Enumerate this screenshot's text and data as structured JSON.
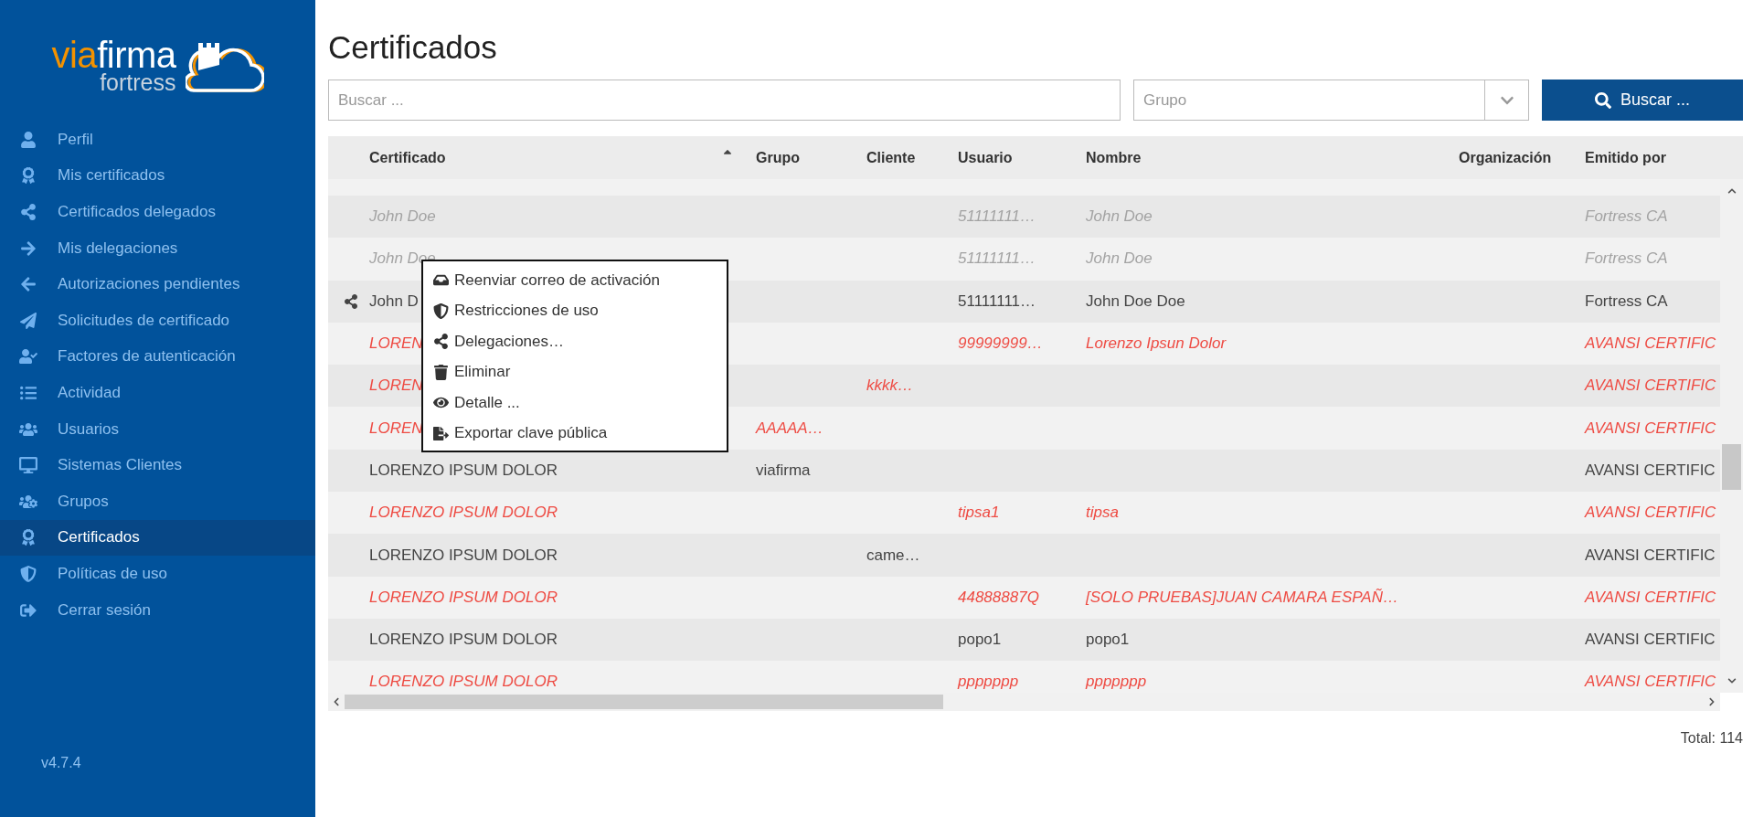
{
  "logo": {
    "accent": "via",
    "name": "firma",
    "tagline": "fortress"
  },
  "sidebar": {
    "items": [
      {
        "label": "Perfil",
        "selected": false
      },
      {
        "label": "Mis certificados",
        "selected": false
      },
      {
        "label": "Certificados delegados",
        "selected": false
      },
      {
        "label": "Mis delegaciones",
        "selected": false
      },
      {
        "label": "Autorizaciones pendientes",
        "selected": false
      },
      {
        "label": "Solicitudes de certificado",
        "selected": false
      },
      {
        "label": "Factores de autenticación",
        "selected": false
      },
      {
        "label": "Actividad",
        "selected": false
      },
      {
        "label": "Usuarios",
        "selected": false
      },
      {
        "label": "Sistemas Clientes",
        "selected": false
      },
      {
        "label": "Grupos",
        "selected": false
      },
      {
        "label": "Certificados",
        "selected": true
      },
      {
        "label": "Políticas de uso",
        "selected": false
      },
      {
        "label": "Cerrar sesión",
        "selected": false
      }
    ],
    "version": "v4.7.4"
  },
  "page_title": "Certificados",
  "search": {
    "placeholder": "Buscar ..."
  },
  "group_select": {
    "placeholder": "Grupo"
  },
  "search_button": "Buscar ...",
  "table": {
    "columns": [
      {
        "label": "Certificado",
        "sorted": true
      },
      {
        "label": "Grupo",
        "sorted": false
      },
      {
        "label": "Cliente",
        "sorted": false
      },
      {
        "label": "Usuario",
        "sorted": false
      },
      {
        "label": "Nombre",
        "sorted": false
      },
      {
        "label": "Organización",
        "sorted": false
      },
      {
        "label": "Emitido por",
        "sorted": false
      }
    ],
    "rows": [
      {
        "kind": "muted",
        "shared": false,
        "cells": [
          "John Doe",
          null,
          null,
          "51111111…",
          "John Doe",
          null,
          "Fortress CA"
        ]
      },
      {
        "kind": "muted",
        "shared": false,
        "cells": [
          "John Doe",
          null,
          null,
          "51111111…",
          "John Doe",
          null,
          "Fortress CA"
        ]
      },
      {
        "kind": "normal",
        "shared": true,
        "cells": [
          "John D",
          null,
          null,
          "51111111…",
          "John Doe Doe",
          null,
          "Fortress CA"
        ]
      },
      {
        "kind": "alert",
        "shared": false,
        "cells": [
          "LOREN",
          null,
          null,
          "99999999…",
          "Lorenzo Ipsun Dolor",
          null,
          "AVANSI CERTIFIC"
        ]
      },
      {
        "kind": "alert",
        "shared": false,
        "cells": [
          "LOREN",
          null,
          "kkkk…",
          null,
          null,
          null,
          "AVANSI CERTIFIC"
        ]
      },
      {
        "kind": "alert",
        "shared": false,
        "cells": [
          "LOREN",
          "AAAAA…",
          null,
          null,
          null,
          null,
          "AVANSI CERTIFIC"
        ]
      },
      {
        "kind": "normal",
        "shared": false,
        "cells": [
          "LORENZO IPSUM DOLOR",
          "viafirma",
          null,
          null,
          null,
          null,
          "AVANSI CERTIFIC"
        ]
      },
      {
        "kind": "alert",
        "shared": false,
        "cells": [
          "LORENZO IPSUM DOLOR",
          null,
          null,
          "tipsa1",
          "tipsa",
          null,
          "AVANSI CERTIFIC"
        ]
      },
      {
        "kind": "normal",
        "shared": false,
        "cells": [
          "LORENZO IPSUM DOLOR",
          null,
          "came…",
          null,
          null,
          null,
          "AVANSI CERTIFIC"
        ]
      },
      {
        "kind": "alert",
        "shared": false,
        "cells": [
          "LORENZO IPSUM DOLOR",
          null,
          null,
          "44888887Q",
          "[SOLO PRUEBAS]JUAN CAMARA ESPAÑ…",
          null,
          "AVANSI CERTIFIC"
        ]
      },
      {
        "kind": "normal",
        "shared": false,
        "cells": [
          "LORENZO IPSUM DOLOR",
          null,
          null,
          "popo1",
          "popo1",
          null,
          "AVANSI CERTIFIC"
        ]
      },
      {
        "kind": "alert",
        "shared": false,
        "cells": [
          "LORENZO IPSUM DOLOR",
          null,
          null,
          "ppppppp",
          "ppppppp",
          null,
          "AVANSI CERTIFIC"
        ]
      }
    ],
    "total": "Total: 114"
  },
  "context_menu": {
    "items": [
      "Reenviar correo de activación",
      "Restricciones de uso",
      "Delegaciones…",
      "Eliminar",
      "Detalle ...",
      "Exportar clave pública"
    ]
  }
}
